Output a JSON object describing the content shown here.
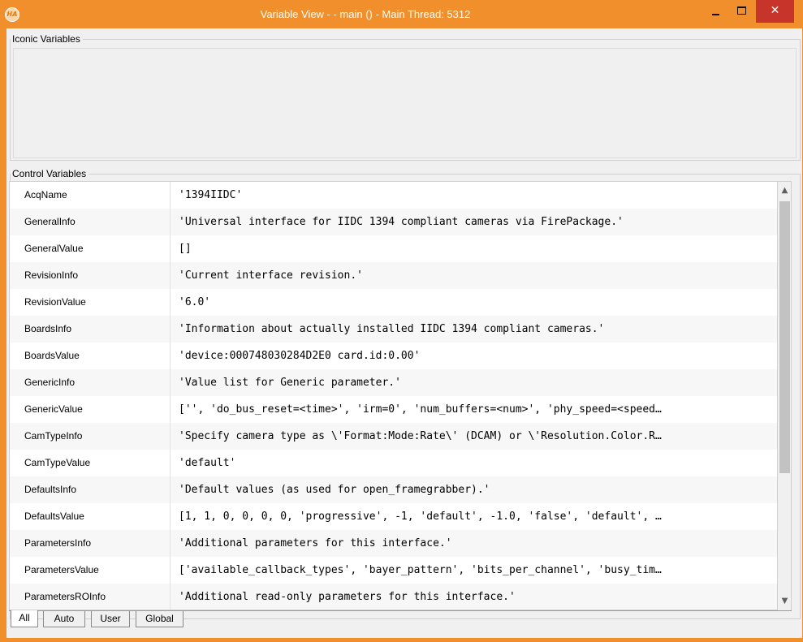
{
  "window": {
    "app_icon": "HA",
    "title": "Variable View -  - main () - Main Thread: 5312",
    "minimize": "minimize-icon",
    "maximize": "maximize-icon",
    "close": "✕"
  },
  "iconic": {
    "label": "Iconic Variables"
  },
  "control": {
    "label": "Control Variables",
    "rows": [
      {
        "name": "AcqName",
        "value": "'1394IIDC'"
      },
      {
        "name": "GeneralInfo",
        "value": "'Universal interface for IIDC 1394 compliant cameras via FirePackage.'"
      },
      {
        "name": "GeneralValue",
        "value": "[]"
      },
      {
        "name": "RevisionInfo",
        "value": "'Current interface revision.'"
      },
      {
        "name": "RevisionValue",
        "value": "'6.0'"
      },
      {
        "name": "BoardsInfo",
        "value": "'Information about actually installed IIDC 1394 compliant cameras.'"
      },
      {
        "name": "BoardsValue",
        "value": "'device:000748030284D2E0 card.id:0.00'"
      },
      {
        "name": "GenericInfo",
        "value": "'Value list for Generic parameter.'"
      },
      {
        "name": "GenericValue",
        "value": "['', 'do_bus_reset=<time>', 'irm=0', 'num_buffers=<num>', 'phy_speed=<speed…"
      },
      {
        "name": "CamTypeInfo",
        "value": "'Specify camera type as \\'Format:Mode:Rate\\' (DCAM) or \\'Resolution.Color.R…"
      },
      {
        "name": "CamTypeValue",
        "value": "'default'"
      },
      {
        "name": "DefaultsInfo",
        "value": "'Default values (as used for open_framegrabber).'"
      },
      {
        "name": "DefaultsValue",
        "value": "[1, 1, 0, 0, 0, 0, 'progressive', -1, 'default', -1.0, 'false', 'default', …"
      },
      {
        "name": "ParametersInfo",
        "value": "'Additional parameters for this interface.'"
      },
      {
        "name": "ParametersValue",
        "value": "['available_callback_types', 'bayer_pattern', 'bits_per_channel', 'busy_tim…"
      },
      {
        "name": "ParametersROInfo",
        "value": "'Additional read-only parameters for this interface.'"
      }
    ]
  },
  "scrollbar": {
    "up_icon": "▲",
    "down_icon": "▼"
  },
  "tabs": [
    {
      "label": "All",
      "active": true
    },
    {
      "label": "Auto",
      "active": false
    },
    {
      "label": "User",
      "active": false
    },
    {
      "label": "Global",
      "active": false
    }
  ]
}
